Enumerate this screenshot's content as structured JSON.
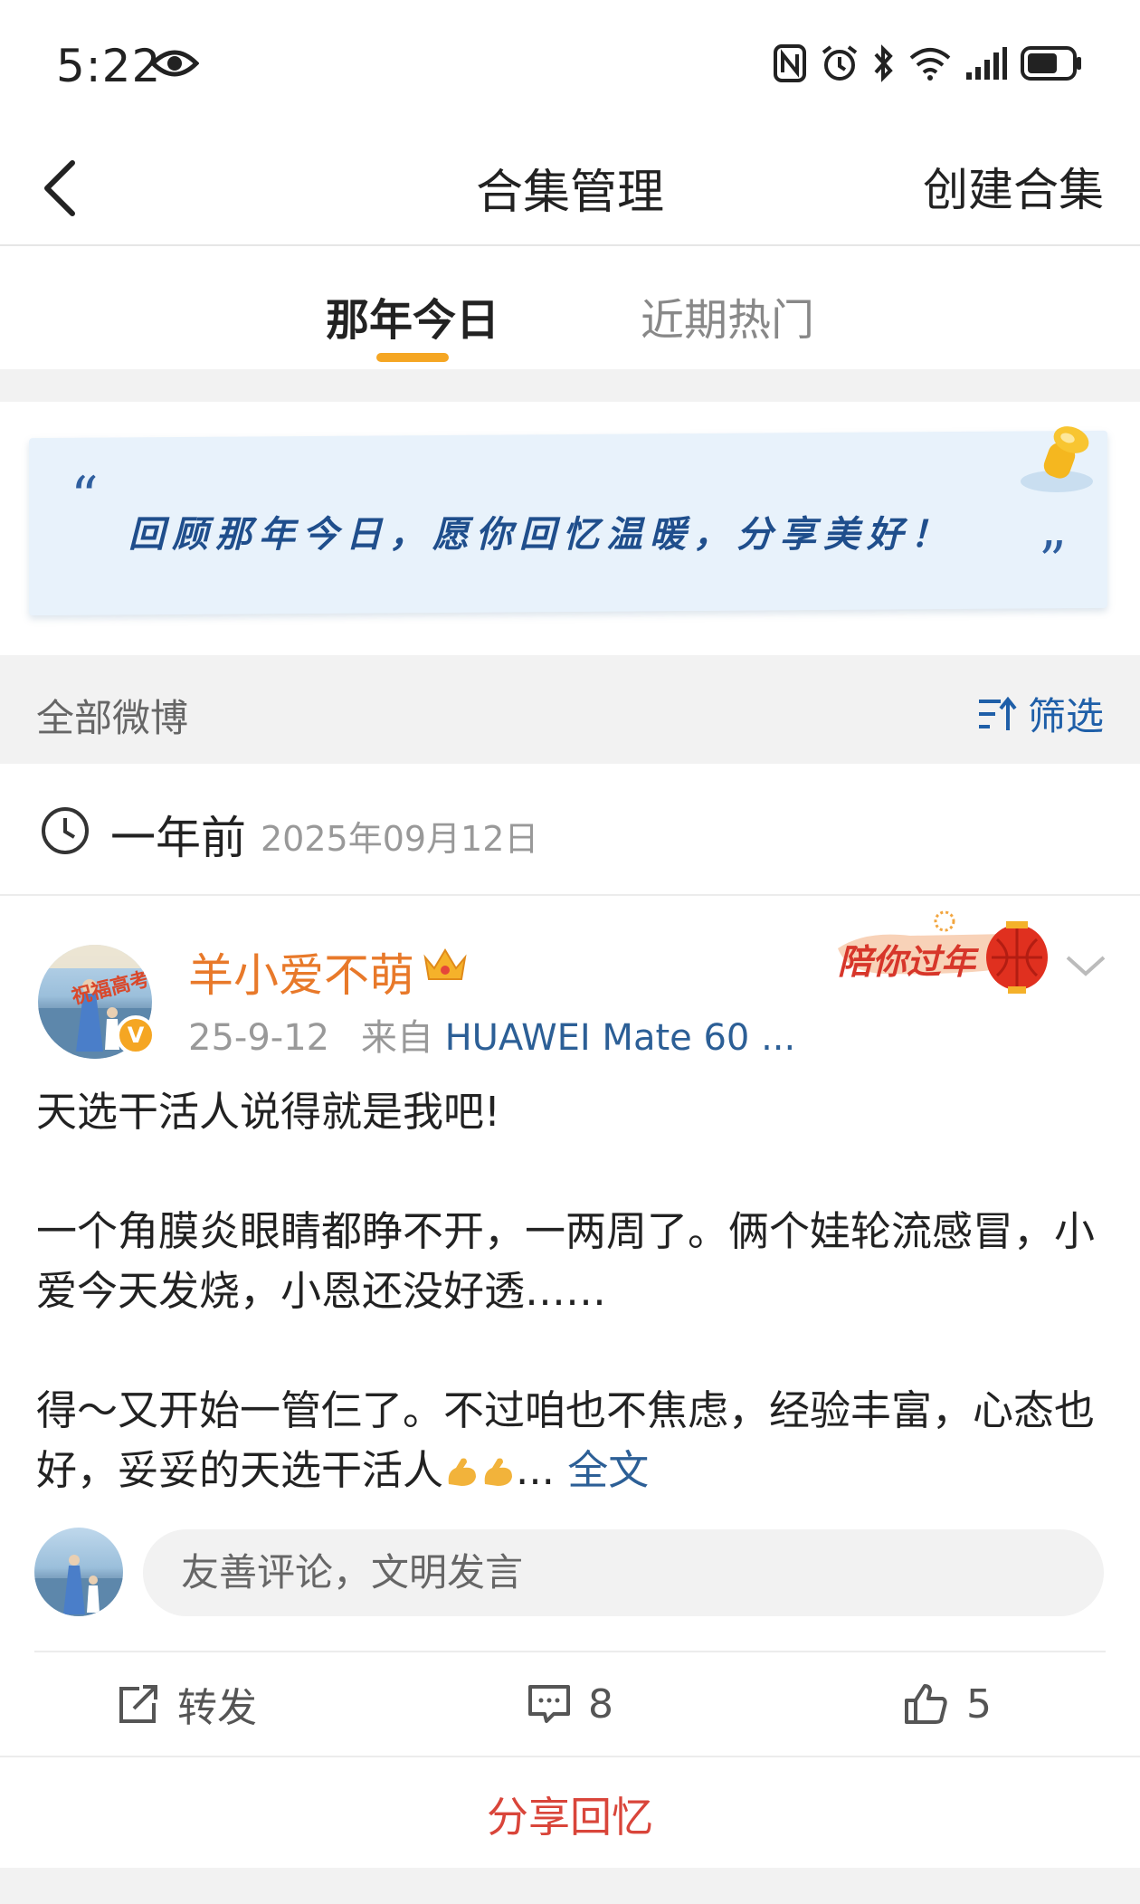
{
  "status_bar": {
    "time": "5:22"
  },
  "header": {
    "title": "合集管理",
    "create_label": "创建合集"
  },
  "tabs": [
    {
      "label": "那年今日",
      "active": true
    },
    {
      "label": "近期热门",
      "active": false
    }
  ],
  "banner": {
    "quote_open": "“",
    "text": "回顾那年今日，愿你回忆温暖，分享美好！",
    "quote_close": "”"
  },
  "filter": {
    "label": "全部微博",
    "button": "筛选"
  },
  "date_row": {
    "relative": "一年前",
    "date": "2025年09月12日"
  },
  "post": {
    "avatar_badge": "祝福高考",
    "username": "羊小爱不萌",
    "meta_date": "25-9-12",
    "meta_from": "来自",
    "meta_source": "HUAWEI Mate 60 ...",
    "event_badge": "陪你过年",
    "paragraphs": [
      "天选干活人说得就是我吧!",
      "一个角膜炎眼睛都睁不开，一两周了。俩个娃轮流感冒，小爱今天发烧，小恩还没好透……",
      "得～又开始一管仨了。不过咱也不焦虑，经验丰富，心态也好，妥妥的天选干活人"
    ],
    "ellipsis": "...",
    "more": "全文",
    "comment_placeholder": "友善评论，文明发言",
    "actions": {
      "repost": "转发",
      "comments": "8",
      "likes": "5"
    }
  },
  "share": {
    "label": "分享回忆"
  },
  "colors": {
    "accent": "#f5a623",
    "link": "#2c5f96",
    "username": "#e8792a",
    "share": "#d9453a"
  }
}
